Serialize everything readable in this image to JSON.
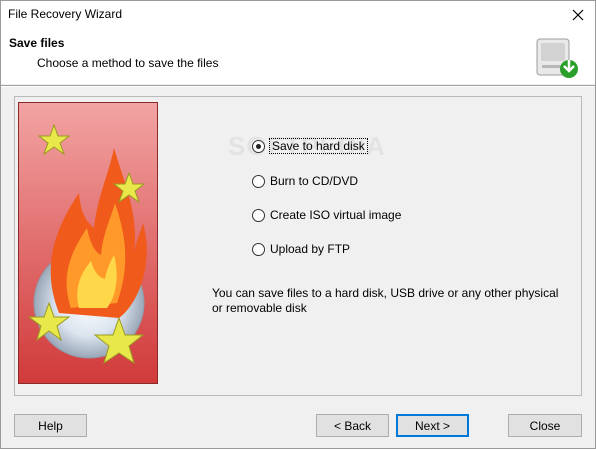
{
  "window": {
    "title": "File Recovery Wizard"
  },
  "header": {
    "title": "Save files",
    "subtitle": "Choose a method to save the files"
  },
  "watermark": "SOFTPEDIA",
  "options": [
    {
      "label": "Save to hard disk",
      "selected": true
    },
    {
      "label": "Burn to CD/DVD",
      "selected": false
    },
    {
      "label": "Create ISO virtual image",
      "selected": false
    },
    {
      "label": "Upload by FTP",
      "selected": false
    }
  ],
  "description": "You can save files to a hard disk, USB drive or any other physical or removable disk",
  "buttons": {
    "help": "Help",
    "back": "< Back",
    "next": "Next >",
    "close": "Close"
  },
  "icons": {
    "close": "close-icon",
    "header": "hard-drive-icon",
    "art": "fire-disc-stars-icon"
  },
  "colors": {
    "accent": "#0078d7",
    "art_background": "#e06c6c"
  }
}
